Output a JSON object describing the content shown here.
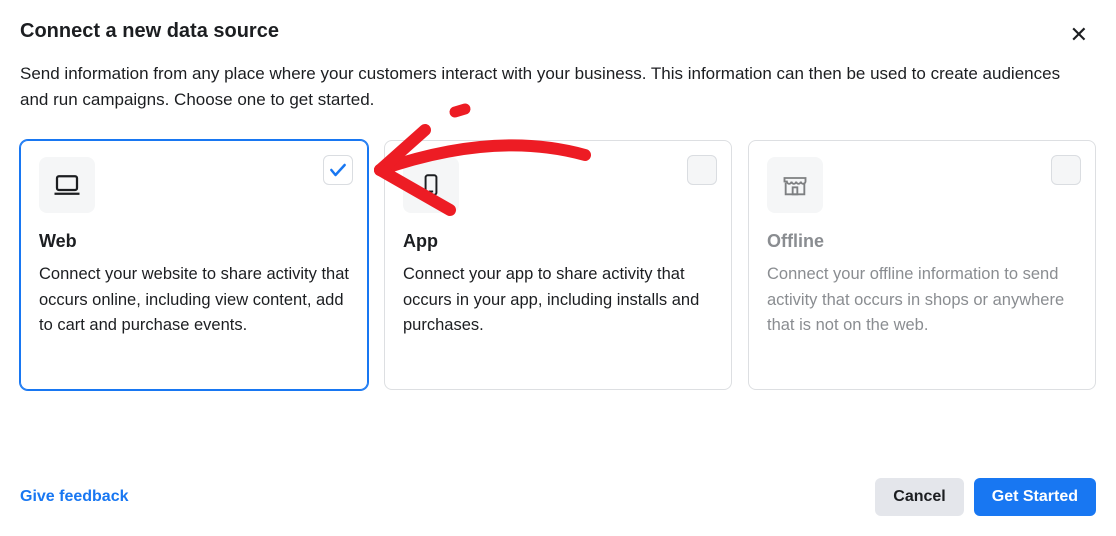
{
  "dialog": {
    "title": "Connect a new data source",
    "description": "Send information from any place where your customers interact with your business. This information can then be used to create audiences and run campaigns. Choose one to get started."
  },
  "cards": [
    {
      "id": "web",
      "title": "Web",
      "description": "Connect your website to share activity that occurs online, including view content, add to cart and purchase events.",
      "icon": "laptop-icon",
      "state": "selected"
    },
    {
      "id": "app",
      "title": "App",
      "description": "Connect your app to share activity that occurs in your app, including installs and purchases.",
      "icon": "mobile-icon",
      "state": "normal"
    },
    {
      "id": "offline",
      "title": "Offline",
      "description": "Connect your offline information to send activity that occurs in shops or anywhere that is not on the web.",
      "icon": "store-icon",
      "state": "disabled"
    }
  ],
  "footer": {
    "feedback_label": "Give feedback",
    "cancel_label": "Cancel",
    "primary_label": "Get Started"
  },
  "close_label": "✕"
}
